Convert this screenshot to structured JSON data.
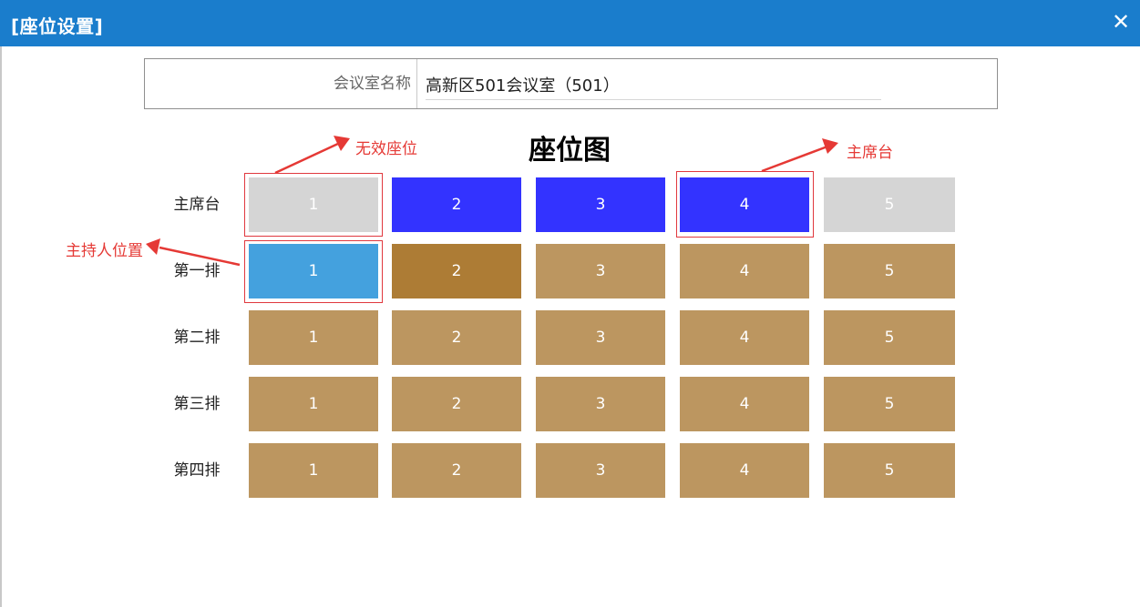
{
  "window": {
    "title": "[座位设置]",
    "close_icon": "close-icon"
  },
  "form": {
    "label": "会议室名称",
    "value": "高新区501会议室（501）"
  },
  "map_title": "座位图",
  "rows": [
    {
      "label": "主席台",
      "seats": [
        "1",
        "2",
        "3",
        "4",
        "5"
      ]
    },
    {
      "label": "第一排",
      "seats": [
        "1",
        "2",
        "3",
        "4",
        "5"
      ]
    },
    {
      "label": "第二排",
      "seats": [
        "1",
        "2",
        "3",
        "4",
        "5"
      ]
    },
    {
      "label": "第三排",
      "seats": [
        "1",
        "2",
        "3",
        "4",
        "5"
      ]
    },
    {
      "label": "第四排",
      "seats": [
        "1",
        "2",
        "3",
        "4",
        "5"
      ]
    }
  ],
  "seat_colors": {
    "invalid": "#d5d5d5",
    "chair": "#3333ff",
    "host": "#44a1de",
    "selected": "#ad7c35",
    "normal": "#bc9660"
  },
  "annotations": {
    "invalid_seat": "无效座位",
    "chair_table": "主席台",
    "host_position": "主持人位置"
  },
  "annotation_color": "#e53935"
}
